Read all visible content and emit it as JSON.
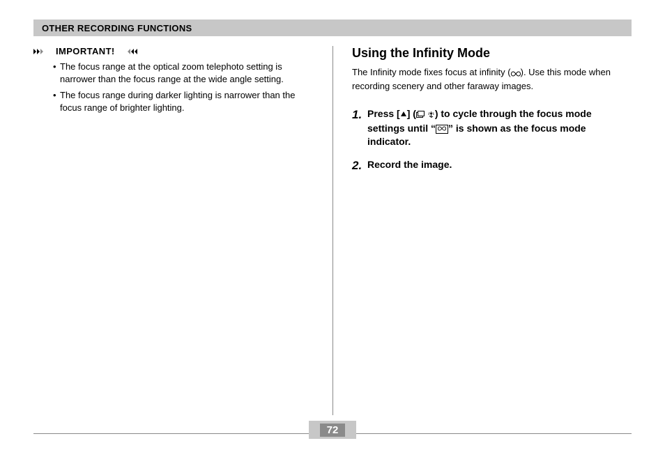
{
  "header": {
    "title": "OTHER RECORDING FUNCTIONS"
  },
  "left": {
    "important_label": "IMPORTANT!",
    "bullets": [
      "The focus range at the optical zoom telephoto setting is narrower than the focus range at the wide angle setting.",
      "The focus range during darker lighting is narrower than the focus range of brighter lighting."
    ]
  },
  "right": {
    "title": "Using the Infinity Mode",
    "intro_a": "The Infinity mode fixes focus at infinity (",
    "intro_b": "). Use this mode when recording scenery and other faraway images.",
    "steps": [
      {
        "num": "1.",
        "pre": "Press [",
        "mid1": "] (",
        "mid2": ") to cycle through the focus mode settings until “",
        "post": "” is shown as the focus mode indicator."
      },
      {
        "num": "2.",
        "text": "Record the image."
      }
    ]
  },
  "page_number": "72"
}
